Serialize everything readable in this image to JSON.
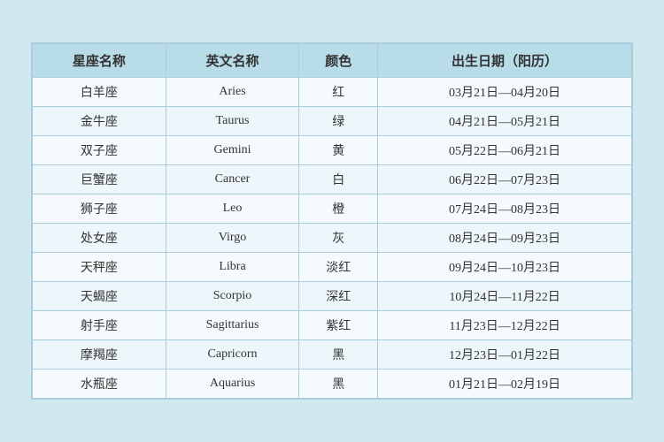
{
  "table": {
    "headers": [
      "星座名称",
      "英文名称",
      "颜色",
      "出生日期（阳历）"
    ],
    "rows": [
      {
        "zh": "白羊座",
        "en": "Aries",
        "color": "红",
        "dates": "03月21日—04月20日"
      },
      {
        "zh": "金牛座",
        "en": "Taurus",
        "color": "绿",
        "dates": "04月21日—05月21日"
      },
      {
        "zh": "双子座",
        "en": "Gemini",
        "color": "黄",
        "dates": "05月22日—06月21日"
      },
      {
        "zh": "巨蟹座",
        "en": "Cancer",
        "color": "白",
        "dates": "06月22日—07月23日"
      },
      {
        "zh": "狮子座",
        "en": "Leo",
        "color": "橙",
        "dates": "07月24日—08月23日"
      },
      {
        "zh": "处女座",
        "en": "Virgo",
        "color": "灰",
        "dates": "08月24日—09月23日"
      },
      {
        "zh": "天秤座",
        "en": "Libra",
        "color": "淡红",
        "dates": "09月24日—10月23日"
      },
      {
        "zh": "天蝎座",
        "en": "Scorpio",
        "color": "深红",
        "dates": "10月24日—11月22日"
      },
      {
        "zh": "射手座",
        "en": "Sagittarius",
        "color": "紫红",
        "dates": "11月23日—12月22日"
      },
      {
        "zh": "摩羯座",
        "en": "Capricorn",
        "color": "黑",
        "dates": "12月23日—01月22日"
      },
      {
        "zh": "水瓶座",
        "en": "Aquarius",
        "color": "黑",
        "dates": "01月21日—02月19日"
      }
    ]
  }
}
